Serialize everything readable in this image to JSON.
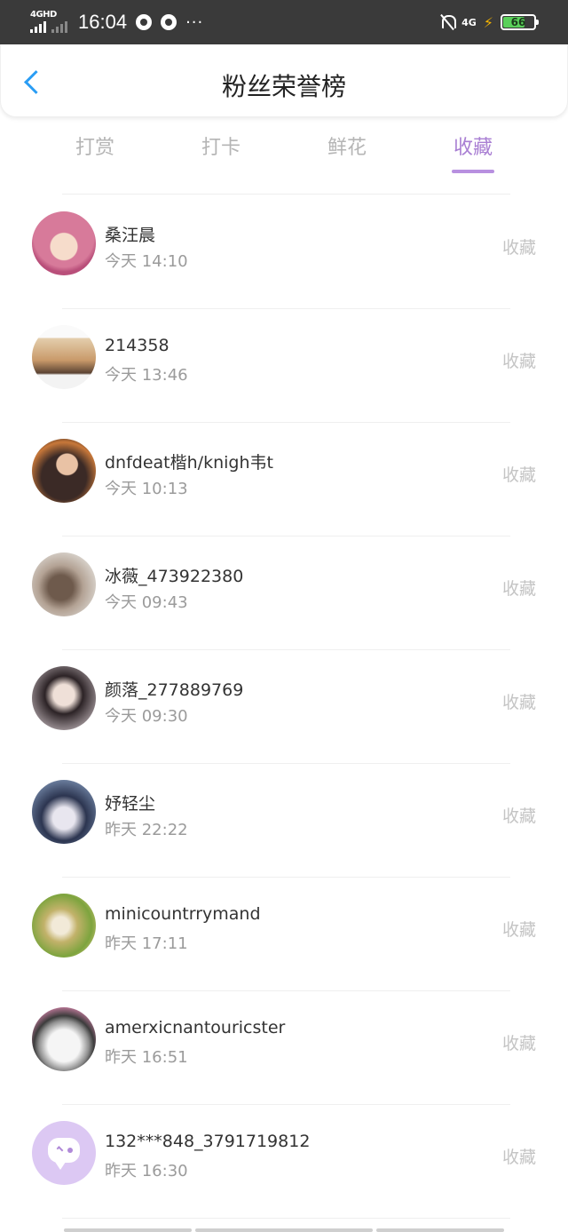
{
  "status_bar": {
    "network": "4GHD",
    "time": "16:04",
    "network_right": "4G",
    "battery": "66",
    "dots": "···"
  },
  "header": {
    "title": "粉丝荣誉榜"
  },
  "tabs": [
    {
      "label": "打赏",
      "active": false
    },
    {
      "label": "打卡",
      "active": false
    },
    {
      "label": "鲜花",
      "active": false
    },
    {
      "label": "收藏",
      "active": true
    }
  ],
  "list": [
    {
      "name": "桑汪晨",
      "time": "今天 14:10",
      "action": "收藏"
    },
    {
      "name": "214358",
      "time": "今天 13:46",
      "action": "收藏"
    },
    {
      "name": "dnfdeat楷h/knigh韦t",
      "time": "今天 10:13",
      "action": "收藏"
    },
    {
      "name": "冰薇_473922380",
      "time": "今天 09:43",
      "action": "收藏"
    },
    {
      "name": "颜落_277889769",
      "time": "今天 09:30",
      "action": "收藏"
    },
    {
      "name": "妤轻尘",
      "time": "昨天 22:22",
      "action": "收藏"
    },
    {
      "name": "minicountrrymand",
      "time": "昨天 17:11",
      "action": "收藏"
    },
    {
      "name": "amerxicnantouricster",
      "time": "昨天 16:51",
      "action": "收藏"
    },
    {
      "name": "132***848_3791719812",
      "time": "昨天 16:30",
      "action": "收藏"
    }
  ],
  "colors": {
    "accent": "#a97fd3",
    "back_arrow": "#2a9df4",
    "muted": "#c4c4c4"
  }
}
